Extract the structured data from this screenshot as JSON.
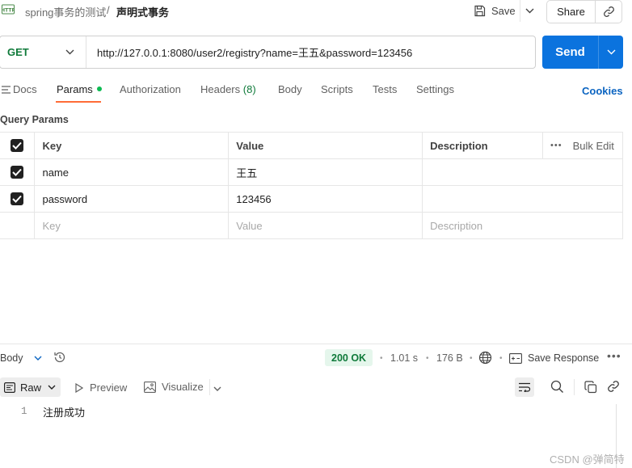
{
  "breadcrumb": {
    "collection": "spring事务的测试",
    "separator": "/",
    "current": "声明式事务"
  },
  "header": {
    "save_label": "Save",
    "share_label": "Share"
  },
  "request": {
    "method": "GET",
    "url": "http://127.0.0.1:8080/user2/registry?name=王五&password=123456",
    "send_label": "Send"
  },
  "tabs": {
    "docs": "Docs",
    "params": "Params",
    "authorization": "Authorization",
    "headers": "Headers",
    "headers_count": "(8)",
    "body": "Body",
    "scripts": "Scripts",
    "tests": "Tests",
    "settings": "Settings",
    "cookies": "Cookies"
  },
  "params": {
    "title": "Query Params",
    "columns": {
      "key": "Key",
      "value": "Value",
      "description": "Description",
      "bulk_edit": "Bulk Edit"
    },
    "rows": [
      {
        "key": "name",
        "value": "王五",
        "description": ""
      },
      {
        "key": "password",
        "value": "123456",
        "description": ""
      }
    ],
    "placeholder": {
      "key": "Key",
      "value": "Value",
      "description": "Description"
    }
  },
  "response": {
    "body_label": "Body",
    "status": "200 OK",
    "time": "1.01 s",
    "size": "176 B",
    "save_response_label": "Save Response",
    "format_label": "Raw",
    "preview_label": "Preview",
    "visualize_label": "Visualize",
    "lines": [
      {
        "number": "1",
        "text": "注册成功"
      }
    ]
  },
  "watermark": "CSDN @弹简特",
  "colors": {
    "accent": "#0b73de",
    "method_get": "#0f7a3a",
    "tab_indicator": "#ff6c37",
    "status_ok_bg": "#e5f6ec",
    "link": "#0b64c1"
  }
}
